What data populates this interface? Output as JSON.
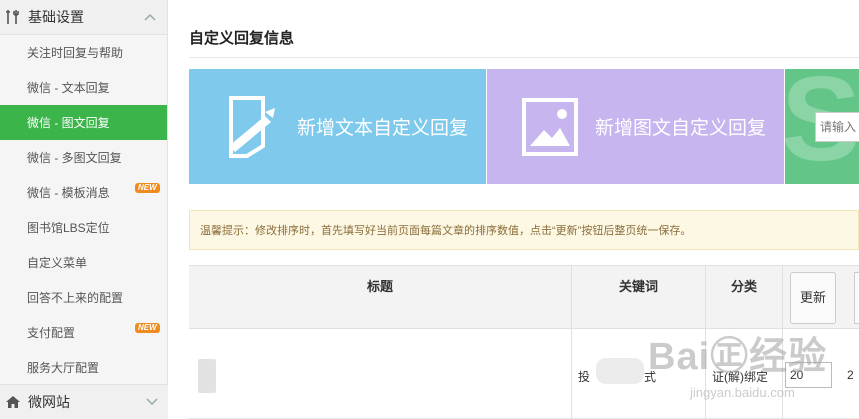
{
  "sidebar": {
    "header_label": "基础设置",
    "items": [
      {
        "label": "关注时回复与帮助"
      },
      {
        "label": "微信 - 文本回复"
      },
      {
        "label": "微信 - 图文回复"
      },
      {
        "label": "微信 - 多图文回复"
      },
      {
        "label": "微信 - 模板消息",
        "badge": "NEW"
      },
      {
        "label": "图书馆LBS定位"
      },
      {
        "label": "自定义菜单"
      },
      {
        "label": "回答不上来的配置"
      },
      {
        "label": "支付配置",
        "badge": "NEW"
      },
      {
        "label": "服务大厅配置"
      }
    ],
    "active_index": 2,
    "footer_label": "微网站"
  },
  "main": {
    "title": "自定义回复信息",
    "tiles": [
      {
        "label": "新增文本自定义回复",
        "color": "#7ec9ec",
        "icon": "edit-document-icon"
      },
      {
        "label": "新增图文自定义回复",
        "color": "#c6b5ee",
        "icon": "image-icon"
      },
      {
        "input_placeholder": "请输入",
        "color": "#63c688"
      }
    ],
    "tip": "温馨提示：修改排序时，首先填写好当前页面每篇文章的排序数值，点击“更新”按钮后整页统一保存。"
  },
  "table": {
    "columns": {
      "title": "标题",
      "keyword": "关键词",
      "category": "分类"
    },
    "update_button": "更新",
    "rows": [
      {
        "keyword_start": "投",
        "keyword_end": "式",
        "category": "证(解)绑定",
        "sort_value": "20",
        "next_col": "2"
      }
    ]
  },
  "watermark": {
    "main": "Bai㊣经验",
    "sub": "jingyan.baidu.com"
  },
  "colors": {
    "active": "#3bb54a",
    "badge": "#f08c1e"
  }
}
